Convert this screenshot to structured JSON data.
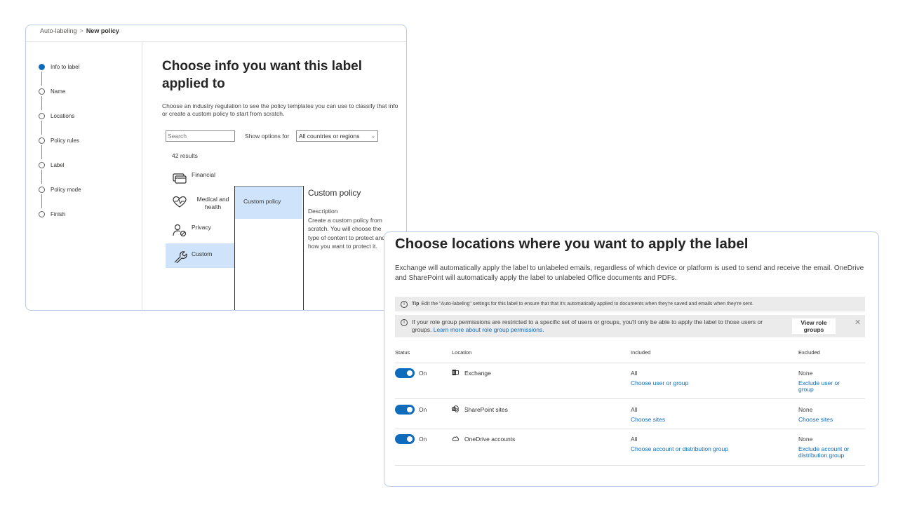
{
  "wizard": {
    "breadcrumb": {
      "parent": "Auto-labeling",
      "separator": ">",
      "current": "New policy"
    },
    "steps": [
      {
        "label": "Info to label",
        "active": true
      },
      {
        "label": "Name",
        "active": false
      },
      {
        "label": "Locations",
        "active": false
      },
      {
        "label": "Policy rules",
        "active": false
      },
      {
        "label": "Label",
        "active": false
      },
      {
        "label": "Policy mode",
        "active": false
      },
      {
        "label": "Finish",
        "active": false
      }
    ],
    "title": "Choose info you want this label applied to",
    "description": "Choose an industry regulation to see the policy templates you can use to classify that info or create a custom policy to start from scratch.",
    "search_placeholder": "Search",
    "show_options_label": "Show options for",
    "region_select": "All countries or regions",
    "results_count": "42 results",
    "categories": [
      {
        "label": "Financial",
        "icon": "credit-card-icon"
      },
      {
        "label": "Medical and health",
        "icon": "heart-pulse-icon"
      },
      {
        "label": "Privacy",
        "icon": "person-shield-icon"
      },
      {
        "label": "Custom",
        "icon": "wrench-icon",
        "selected": true
      }
    ],
    "policy_items": [
      "Custom policy"
    ],
    "detail": {
      "title": "Custom policy",
      "description_heading": "Description",
      "description": "Create a custom policy from scratch. You will choose the type of content to protect and how you want to protect it."
    }
  },
  "locations": {
    "title": "Choose locations where you want to apply the label",
    "description": "Exchange will automatically apply the label to unlabeled emails, regardless of which device or platform is used to send and receive the email. OneDrive and SharePoint will automatically apply the label to unlabeled Office documents and PDFs.",
    "tip": {
      "bold": "Tip",
      "text": "Edit the \"Auto-labeling\" settings for this label to ensure that that it's automatically applied to documents when they're saved and emails when they're sent."
    },
    "info": {
      "text": "If your role group permissions are restricted to a specific set of users or groups, you'll only be able to apply the label to those users or groups.",
      "link": "Learn more about role group permissions.",
      "button": "View role groups"
    },
    "columns": {
      "status": "Status",
      "location": "Location",
      "included": "Included",
      "excluded": "Excluded"
    },
    "rows": [
      {
        "status": "On",
        "location": "Exchange",
        "icon": "exchange-icon",
        "included": "All",
        "included_link": "Choose user or group",
        "excluded": "None",
        "excluded_link": "Exclude user or group"
      },
      {
        "status": "On",
        "location": "SharePoint sites",
        "icon": "sharepoint-icon",
        "included": "All",
        "included_link": "Choose sites",
        "excluded": "None",
        "excluded_link": "Choose sites"
      },
      {
        "status": "On",
        "location": "OneDrive accounts",
        "icon": "onedrive-icon",
        "included": "All",
        "included_link": "Choose account or distribution group",
        "excluded": "None",
        "excluded_link": "Exclude account or distribution group"
      }
    ]
  },
  "colors": {
    "accent": "#0f6cbd",
    "selected_bg": "#cfe4fa",
    "bar_bg": "#ebebeb"
  }
}
